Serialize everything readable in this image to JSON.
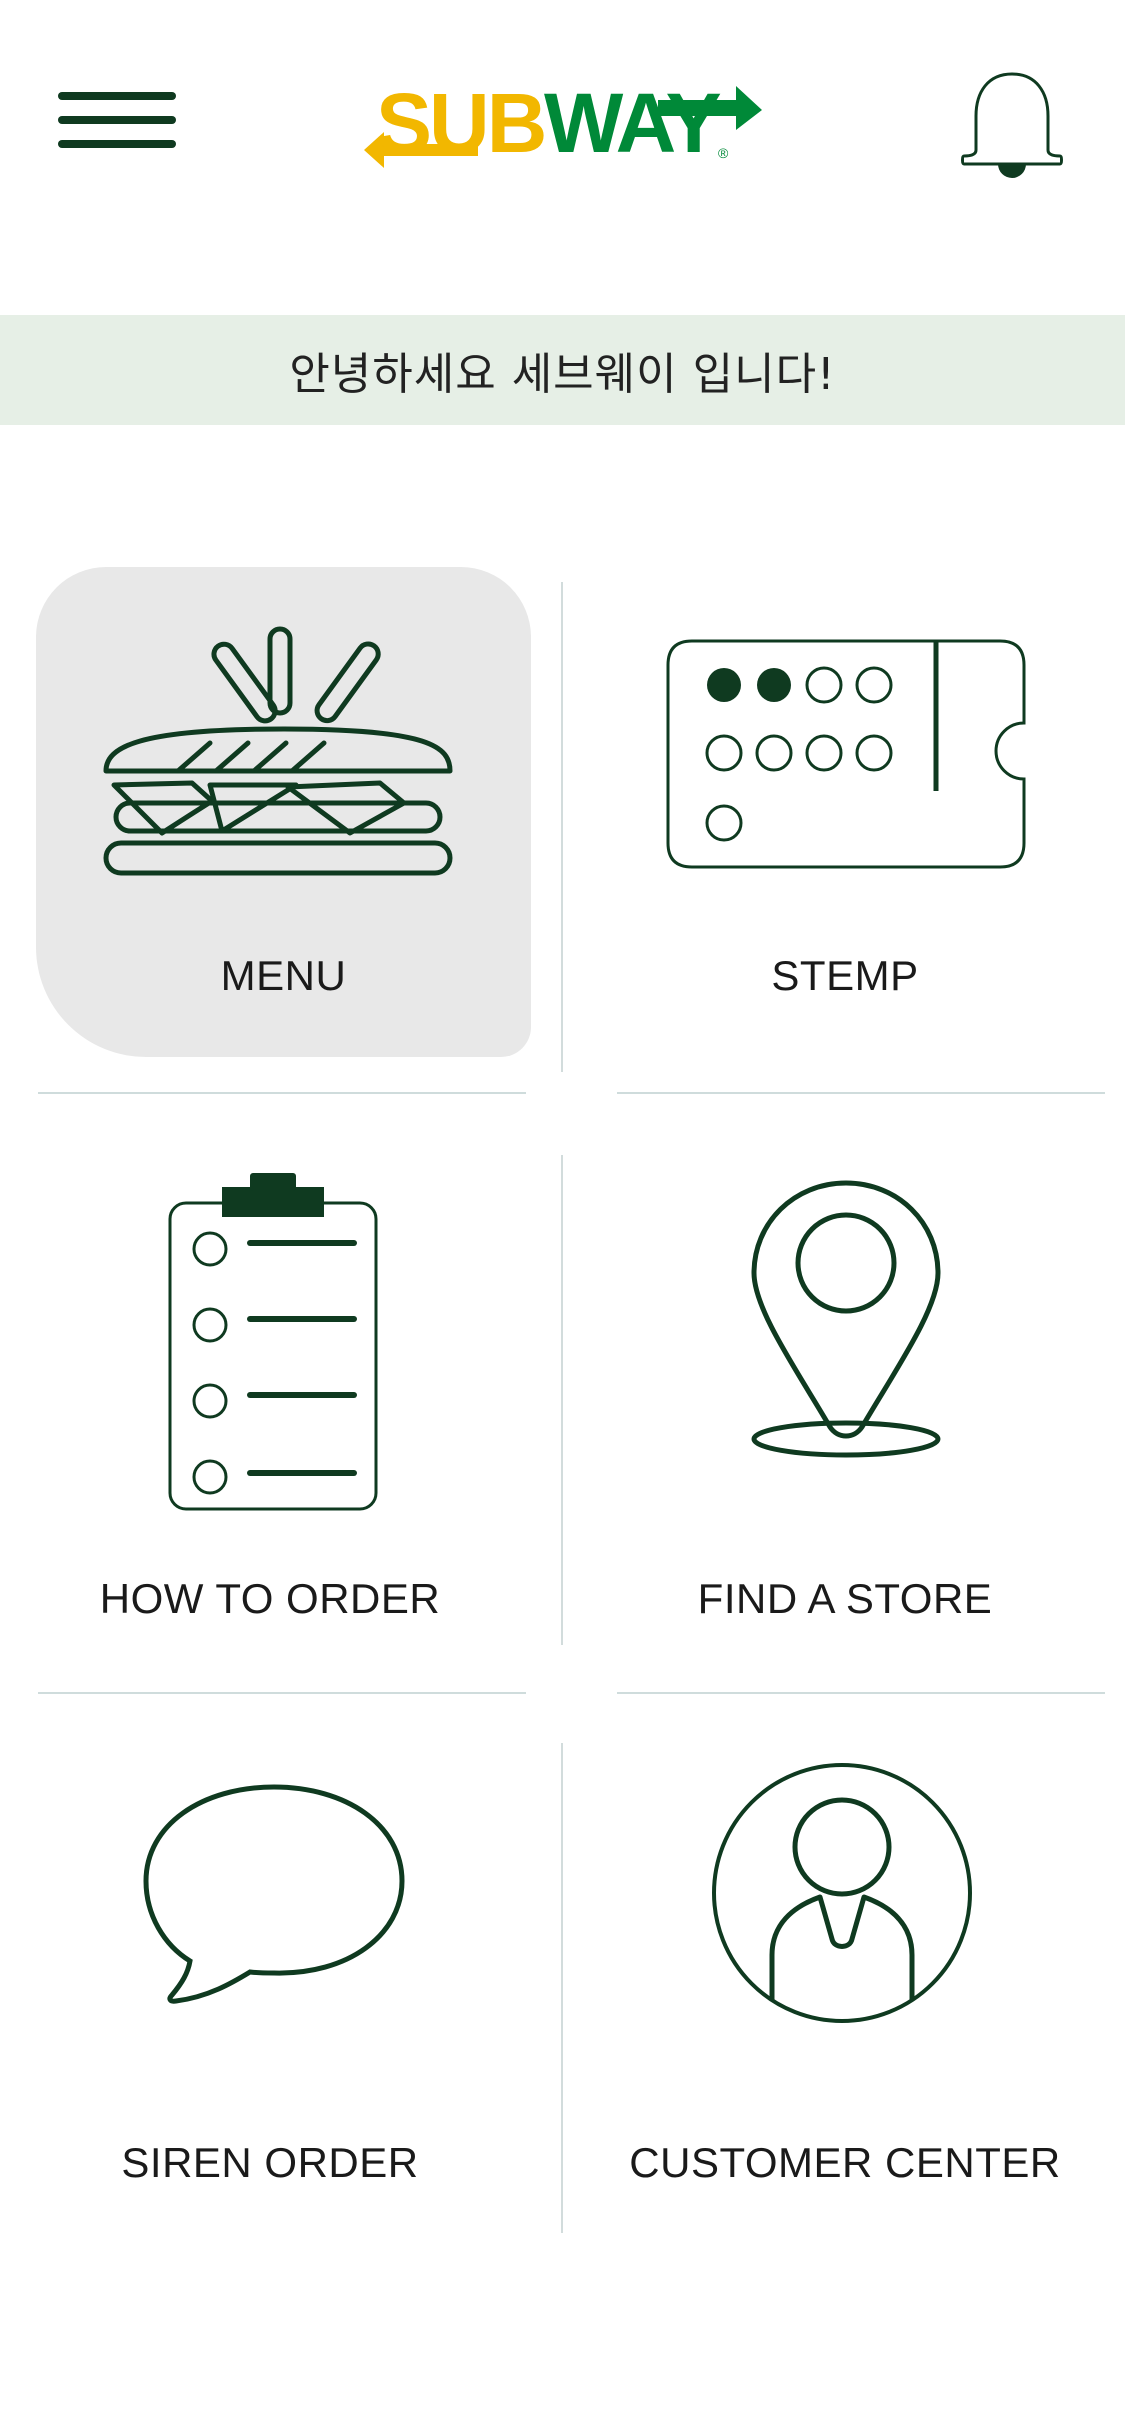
{
  "header": {
    "logo": {
      "part1": "SUB",
      "part2": "WAY",
      "mark": "®"
    },
    "menu_icon": "hamburger-menu-icon",
    "notification_icon": "bell-icon"
  },
  "banner": {
    "greeting": "안녕하세요 세브웨이 입니다!"
  },
  "menu_grid": [
    {
      "id": "menu",
      "label": "MENU",
      "icon": "sandwich-icon",
      "selected": true
    },
    {
      "id": "stemp",
      "label": "STEMP",
      "icon": "stamp-card-icon",
      "stamps_filled": 2,
      "stamps_total": 9
    },
    {
      "id": "how-to-order",
      "label": "HOW TO ORDER",
      "icon": "clipboard-checklist-icon"
    },
    {
      "id": "find-a-store",
      "label": "FIND A STORE",
      "icon": "location-pin-icon"
    },
    {
      "id": "siren-order",
      "label": "SIREN ORDER",
      "icon": "speech-bubble-icon"
    },
    {
      "id": "customer-center",
      "label": "CUSTOMER CENTER",
      "icon": "person-circle-icon"
    }
  ],
  "colors": {
    "brand_green": "#008938",
    "brand_yellow": "#f2b700",
    "dark_green": "#0f3a20",
    "banner_bg": "#e6efe6",
    "selected_tile_bg": "#e8e8e8"
  }
}
